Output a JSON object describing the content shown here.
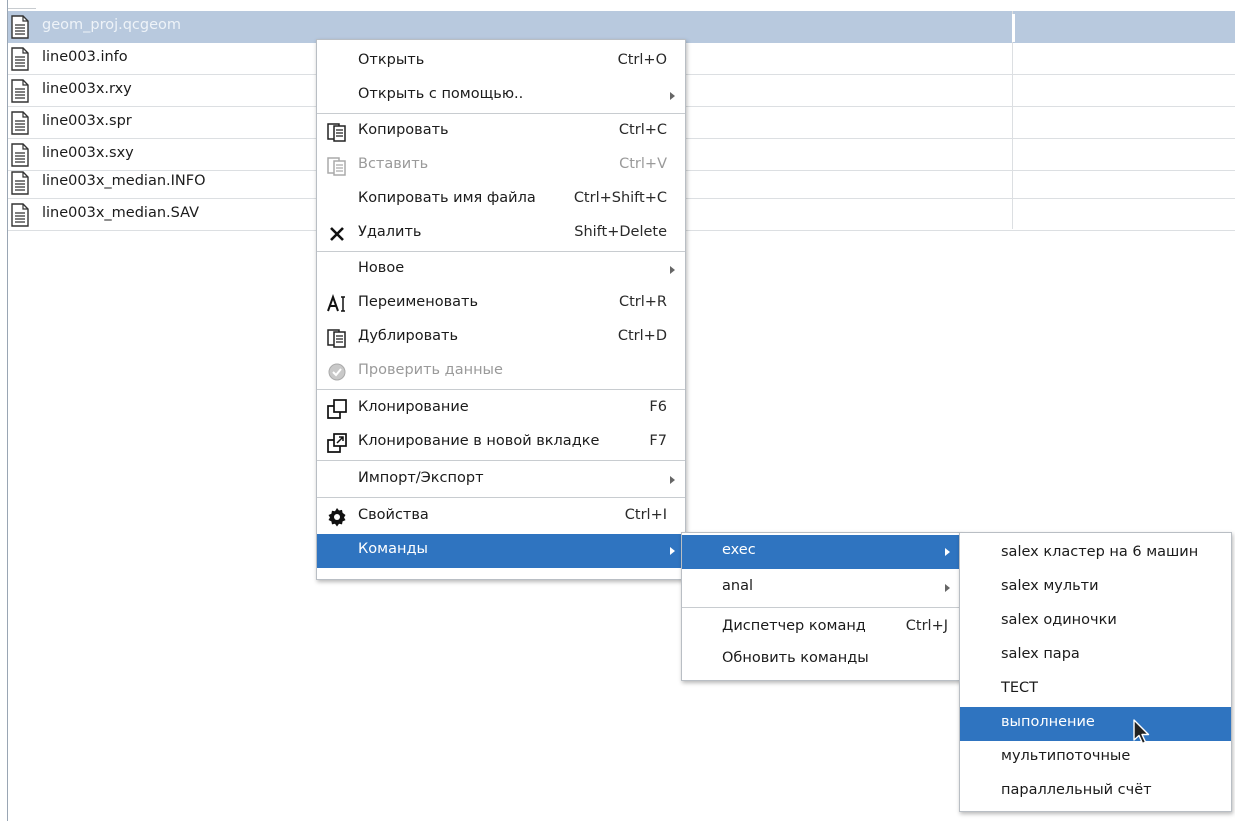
{
  "files": [
    {
      "name": "geom_proj.qcgeom",
      "selected": true,
      "icon": "document-icon"
    },
    {
      "name": "line003.info",
      "icon": "document-icon"
    },
    {
      "name": "line003x.rxy",
      "icon": "document-icon"
    },
    {
      "name": "line003x.spr",
      "icon": "document-icon"
    },
    {
      "name": "line003x.sxy",
      "icon": "document-icon"
    },
    {
      "name": "line003x_median.INFO",
      "icon": "document-icon"
    },
    {
      "name": "line003x_median.SAV",
      "icon": "document-icon"
    }
  ],
  "context_menu": {
    "items": [
      {
        "label": "Открыть",
        "shortcut": "Ctrl+O"
      },
      {
        "label": "Открыть с помощью..",
        "submenu": true
      },
      {
        "label": "Копировать",
        "shortcut": "Ctrl+C",
        "icon": "copy-icon"
      },
      {
        "label": "Вставить",
        "shortcut": "Ctrl+V",
        "icon": "paste-icon",
        "disabled": true
      },
      {
        "label": "Копировать имя файла",
        "shortcut": "Ctrl+Shift+C"
      },
      {
        "label": "Удалить",
        "shortcut": "Shift+Delete",
        "icon": "delete-x-icon"
      },
      {
        "label": "Новое",
        "submenu": true
      },
      {
        "label": "Переименовать",
        "shortcut": "Ctrl+R",
        "icon": "rename-text-icon"
      },
      {
        "label": "Дублировать",
        "shortcut": "Ctrl+D",
        "icon": "duplicate-icon"
      },
      {
        "label": "Проверить данные",
        "icon": "check-circle-icon",
        "disabled": true
      },
      {
        "label": "Клонирование",
        "shortcut": "F6",
        "icon": "clone-icon"
      },
      {
        "label": "Клонирование в новой вкладке",
        "shortcut": "F7",
        "icon": "clone-new-tab-icon"
      },
      {
        "label": "Импорт/Экспорт",
        "submenu": true
      },
      {
        "label": "Свойства",
        "shortcut": "Ctrl+I",
        "icon": "gear-icon"
      },
      {
        "label": "Команды",
        "submenu": true,
        "active": true
      }
    ]
  },
  "commands_menu": {
    "items": [
      {
        "label": "exec",
        "submenu": true,
        "active": true
      },
      {
        "label": "anal",
        "submenu": true
      },
      {
        "label": "Диспетчер команд",
        "shortcut": "Ctrl+J"
      },
      {
        "label": "Обновить команды"
      }
    ]
  },
  "exec_menu": {
    "items": [
      {
        "label": "salex кластер на 6 машин"
      },
      {
        "label": "salex мульти"
      },
      {
        "label": "salex одиночки"
      },
      {
        "label": "salex пара"
      },
      {
        "label": "ТЕСТ"
      },
      {
        "label": "выполнение",
        "active": true
      },
      {
        "label": "мультипоточные"
      },
      {
        "label": "параллельный счёт"
      }
    ]
  },
  "colors": {
    "selection_row": "#b8c9de",
    "menu_highlight": "#2f74c0",
    "disabled_text": "#9a9a9a"
  }
}
